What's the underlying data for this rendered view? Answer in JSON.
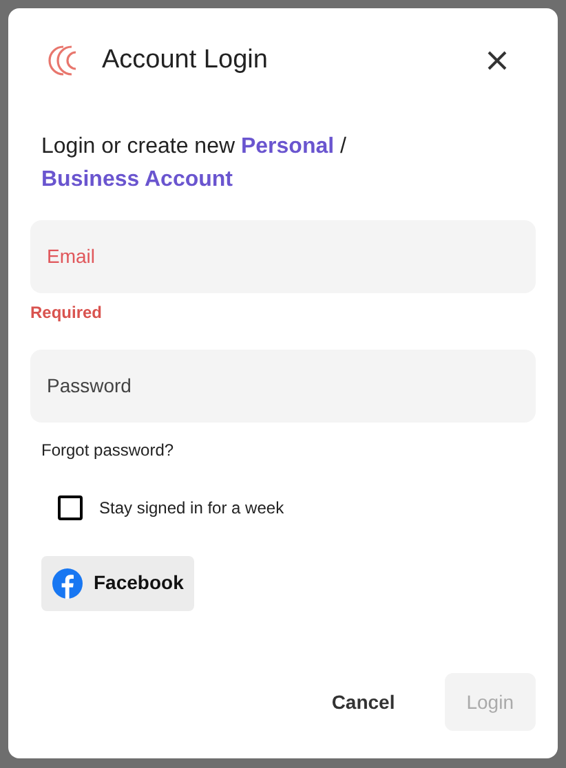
{
  "dialog": {
    "title": "Account Login"
  },
  "intro": {
    "text": "Login or create new",
    "links": [
      "Personal",
      "Business Account"
    ],
    "separator": "/"
  },
  "fields": [
    {
      "placeholder": "Email",
      "error": true
    },
    {
      "placeholder": "Password",
      "error": false
    }
  ],
  "email_error": "Required",
  "forgot_link": "Forgot password?",
  "remember": {
    "label": "Stay signed in for a week",
    "checked": false
  },
  "social_button": "Facebook",
  "buttons": {
    "cancel": "Cancel",
    "login": {
      "label": "Login",
      "disabled": true
    }
  }
}
